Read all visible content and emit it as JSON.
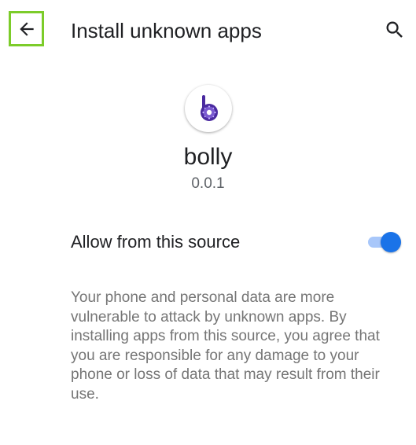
{
  "toolbar": {
    "title": "Install unknown apps",
    "back_icon": "arrow-left-icon",
    "search_icon": "search-icon",
    "highlight_color": "#7ccc2a"
  },
  "app": {
    "name": "bolly",
    "version": "0.0.1",
    "icon": "bolly-app-icon",
    "icon_color": "#4a2aa0"
  },
  "setting": {
    "label": "Allow from this source",
    "enabled": true,
    "accent": "#1a73e8"
  },
  "description": "Your phone and personal data are more vulnerable to attack by unknown apps. By installing apps from this source, you agree that you are responsible for any damage to your phone or loss of data that may result from their use."
}
